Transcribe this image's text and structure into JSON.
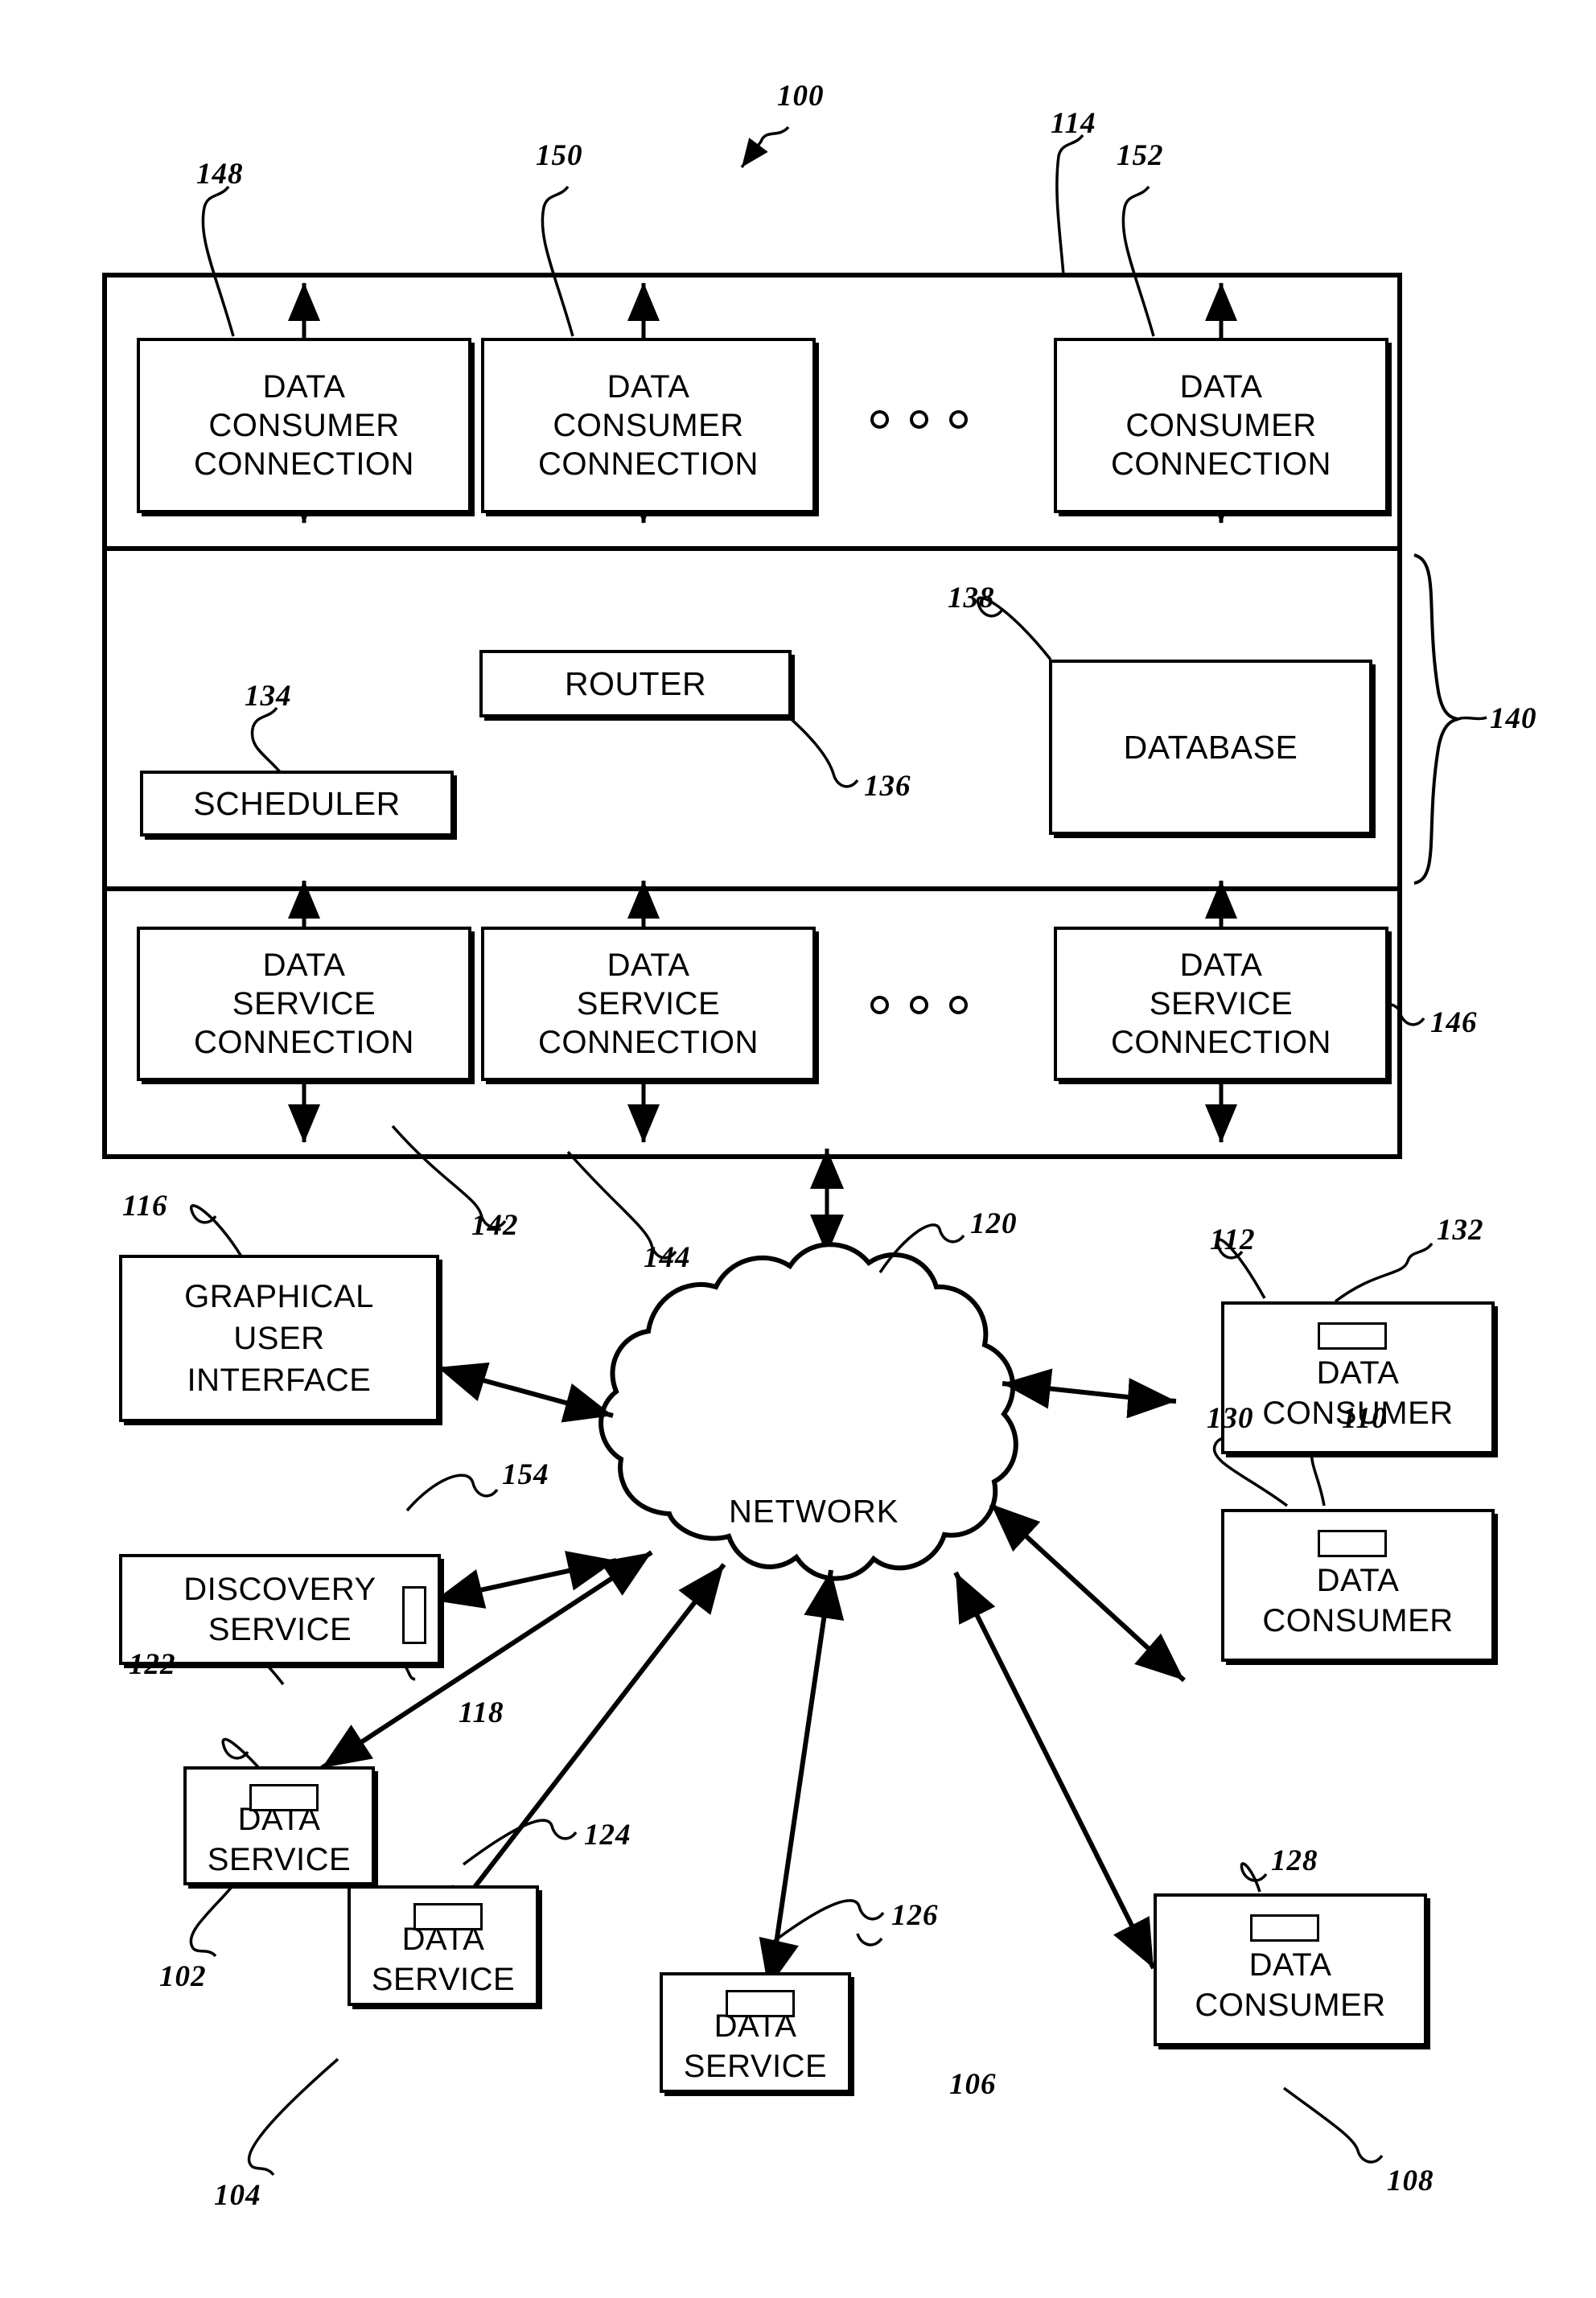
{
  "figure": {
    "system_ref": "100",
    "outer_frame_ref": "114",
    "middle_group_ref": "140"
  },
  "consumer_connections": {
    "lines": [
      "DATA",
      "CONSUMER",
      "CONNECTION"
    ],
    "refs": [
      "148",
      "150",
      "152"
    ],
    "ellipsis": "o o o"
  },
  "service_connections": {
    "lines": [
      "DATA",
      "SERVICE",
      "CONNECTION"
    ],
    "refs": [
      "142",
      "144",
      "146"
    ],
    "ellipsis": "o o o"
  },
  "middle": {
    "scheduler": {
      "label": "SCHEDULER",
      "ref": "134"
    },
    "router": {
      "label": "ROUTER",
      "ref": "136"
    },
    "database": {
      "label": "DATABASE",
      "ref": "138"
    },
    "group_ref": "140"
  },
  "network": {
    "label": "NETWORK",
    "ref": "120"
  },
  "gui": {
    "lines": [
      "GRAPHICAL",
      "USER",
      "INTERFACE"
    ],
    "ref": "116"
  },
  "discovery_service": {
    "lines": [
      "DISCOVERY",
      "SERVICE"
    ],
    "ref": "118",
    "tab_ref": "154"
  },
  "data_services": [
    {
      "lines": [
        "DATA",
        "SERVICE"
      ],
      "ref": "102",
      "tab_ref": "122"
    },
    {
      "lines": [
        "DATA",
        "SERVICE"
      ],
      "ref": "104",
      "tab_ref": "124"
    },
    {
      "lines": [
        "DATA",
        "SERVICE"
      ],
      "ref": "106",
      "tab_ref": "126"
    }
  ],
  "data_consumers": [
    {
      "lines": [
        "DATA",
        "CONSUMER"
      ],
      "ref": "112",
      "tab_ref": "132"
    },
    {
      "lines": [
        "DATA",
        "CONSUMER"
      ],
      "ref": "110",
      "tab_ref": "130"
    },
    {
      "lines": [
        "DATA",
        "CONSUMER"
      ],
      "ref": "108",
      "tab_ref": "128"
    }
  ],
  "refs": {
    "r100": "100",
    "r102": "102",
    "r104": "104",
    "r106": "106",
    "r108": "108",
    "r110": "110",
    "r112": "112",
    "r114": "114",
    "r116": "116",
    "r118": "118",
    "r120": "120",
    "r122": "122",
    "r124": "124",
    "r126": "126",
    "r128": "128",
    "r130": "130",
    "r132": "132",
    "r134": "134",
    "r136": "136",
    "r138": "138",
    "r140": "140",
    "r142": "142",
    "r144": "144",
    "r146": "146",
    "r148": "148",
    "r150": "150",
    "r152": "152",
    "r154": "154"
  },
  "colors": {
    "ink": "#000000",
    "paper": "#ffffff"
  }
}
